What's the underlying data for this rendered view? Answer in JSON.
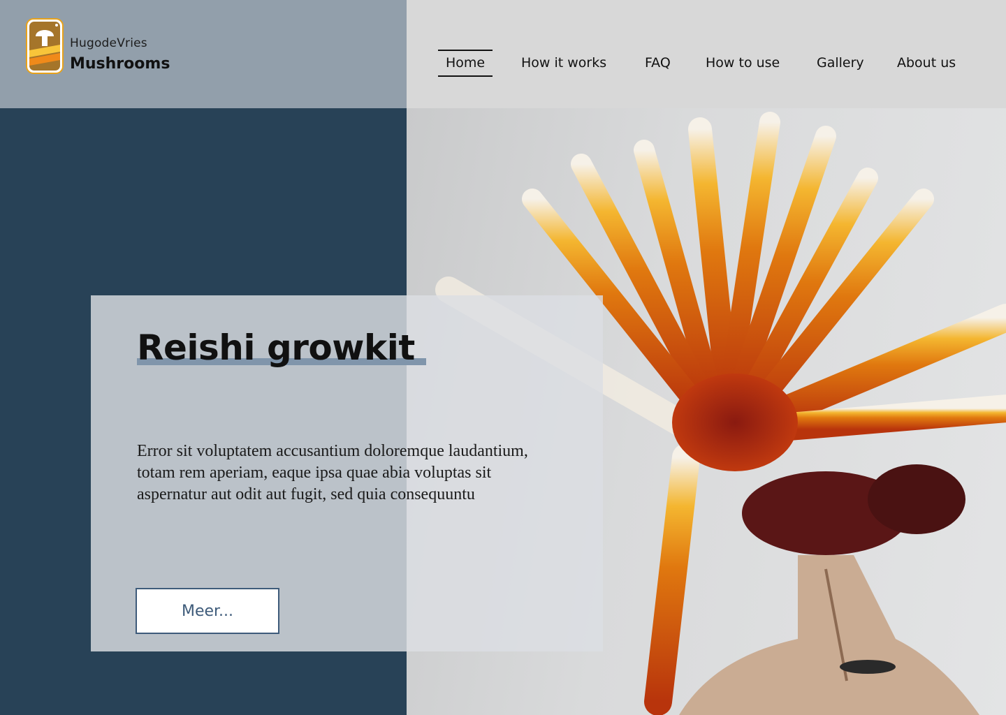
{
  "brand": {
    "top_label": "HugodeVries",
    "main_label": "Mushrooms"
  },
  "nav": {
    "items": [
      {
        "label": "Home",
        "active": true
      },
      {
        "label": "How it works",
        "active": false
      },
      {
        "label": "FAQ",
        "active": false
      },
      {
        "label": "How to use",
        "active": false
      },
      {
        "label": "Gallery",
        "active": false
      },
      {
        "label": "About us",
        "active": false
      }
    ]
  },
  "hero": {
    "title": "Reishi growkit",
    "body": "Error sit voluptatem accusantium doloremque laudantium, totam rem aperiam, eaque ipsa quae abia voluptas sit aspernatur aut odit aut fugit, sed quia consequuntu",
    "button_label": "Meer..."
  },
  "colors": {
    "header_left": "#929fab",
    "header_right": "#d8d8d8",
    "dark_panel": "#284257",
    "accent": "#3e5b7a",
    "underline": "#8095ab"
  },
  "icons": {
    "logo": "mushroom-logo-icon"
  }
}
